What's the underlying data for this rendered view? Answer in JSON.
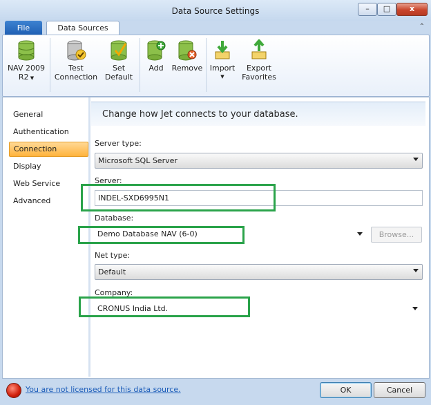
{
  "window": {
    "title": "Data Source Settings",
    "close_glyph": "x",
    "min_glyph": "–",
    "max_glyph": "□"
  },
  "tabs": {
    "file": "File",
    "active": "Data Sources",
    "collapse_glyph": "⌃"
  },
  "ribbon": {
    "nav": {
      "line1": "NAV 2009",
      "line2": "R2",
      "icon": "database-icon"
    },
    "test": {
      "line1": "Test",
      "line2": "Connection",
      "icon": "test-connection-icon"
    },
    "default": {
      "line1": "Set",
      "line2": "Default",
      "icon": "set-default-icon"
    },
    "add": {
      "label": "Add",
      "icon": "add-database-icon"
    },
    "remove": {
      "label": "Remove",
      "icon": "remove-database-icon"
    },
    "import": {
      "label": "Import",
      "icon": "import-icon"
    },
    "export": {
      "line1": "Export",
      "line2": "Favorites",
      "icon": "export-icon"
    }
  },
  "nav_items": [
    "General",
    "Authentication",
    "Connection",
    "Display",
    "Web Service",
    "Advanced"
  ],
  "active_nav": "Connection",
  "panel": {
    "title": "Change how Jet connects to your database.",
    "server_type": {
      "label": "Server type:",
      "value": "Microsoft SQL Server"
    },
    "server": {
      "label": "Server:",
      "value": "INDEL-SXD6995N1"
    },
    "database": {
      "label": "Database:",
      "value": "Demo Database NAV (6-0)",
      "browse": "Browse..."
    },
    "net_type": {
      "label": "Net type:",
      "value": "Default"
    },
    "company": {
      "label": "Company:",
      "value": "CRONUS India Ltd."
    }
  },
  "footer": {
    "status": "You are not licensed for this data source.",
    "ok": "OK",
    "cancel": "Cancel"
  },
  "colors": {
    "highlight": "#2aa34a",
    "active_nav": "#ffb33d",
    "link": "#1a5bb8",
    "error": "#d01f0a"
  }
}
